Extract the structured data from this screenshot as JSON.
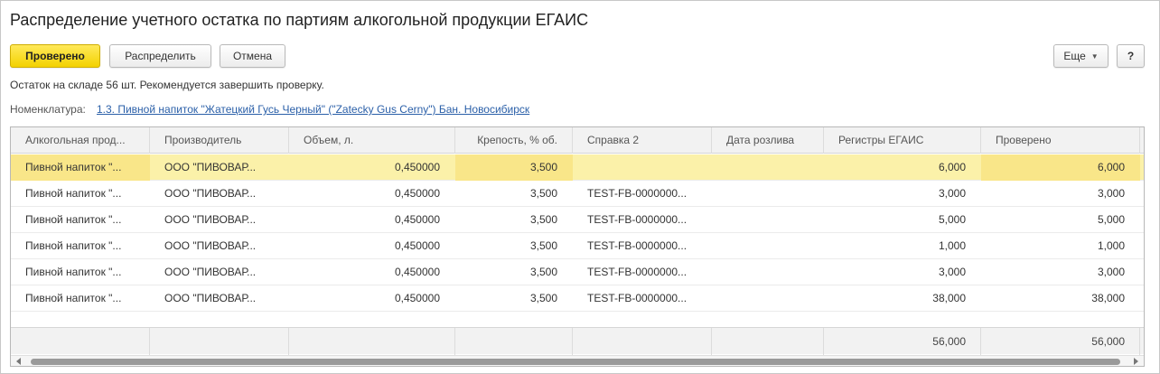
{
  "window": {
    "title": "Распределение учетного остатка по партиям алкогольной продукции ЕГАИС"
  },
  "toolbar": {
    "checked_label": "Проверено",
    "distribute_label": "Распределить",
    "cancel_label": "Отмена",
    "more_label": "Еще",
    "help_label": "?"
  },
  "info": {
    "message": "Остаток на складе 56 шт. Рекомендуется завершить проверку.",
    "nomenclature_label": "Номенклатура:",
    "nomenclature_value": "1.3. Пивной напиток \"Жатецкий Гусь Черный\" (\"Zatecky Gus Cerny\") Бан. Новосибирск"
  },
  "table": {
    "columns": [
      "Алкогольная прод...",
      "Производитель",
      "Объем, л.",
      "Крепость, % об.",
      "Справка 2",
      "Дата розлива",
      "Регистры ЕГАИС",
      "Проверено"
    ],
    "rows": [
      [
        "Пивной напиток \"...",
        "ООО \"ПИВОВАР...",
        "0,450000",
        "3,500",
        "",
        "",
        "6,000",
        "6,000"
      ],
      [
        "Пивной напиток \"...",
        "ООО \"ПИВОВАР...",
        "0,450000",
        "3,500",
        "TEST-FB-0000000...",
        "",
        "3,000",
        "3,000"
      ],
      [
        "Пивной напиток \"...",
        "ООО \"ПИВОВАР...",
        "0,450000",
        "3,500",
        "TEST-FB-0000000...",
        "",
        "5,000",
        "5,000"
      ],
      [
        "Пивной напиток \"...",
        "ООО \"ПИВОВАР...",
        "0,450000",
        "3,500",
        "TEST-FB-0000000...",
        "",
        "1,000",
        "1,000"
      ],
      [
        "Пивной напиток \"...",
        "ООО \"ПИВОВАР...",
        "0,450000",
        "3,500",
        "TEST-FB-0000000...",
        "",
        "3,000",
        "3,000"
      ],
      [
        "Пивной напиток \"...",
        "ООО \"ПИВОВАР...",
        "0,450000",
        "3,500",
        "TEST-FB-0000000...",
        "",
        "38,000",
        "38,000"
      ]
    ],
    "totals": {
      "registers_total": "56,000",
      "checked_total": "56,000"
    },
    "selected_row_color": "#fbf1a9"
  },
  "icons": {
    "more": "chevron-down-icon",
    "scroll_left": "arrow-left-icon",
    "scroll_right": "arrow-right-icon"
  }
}
